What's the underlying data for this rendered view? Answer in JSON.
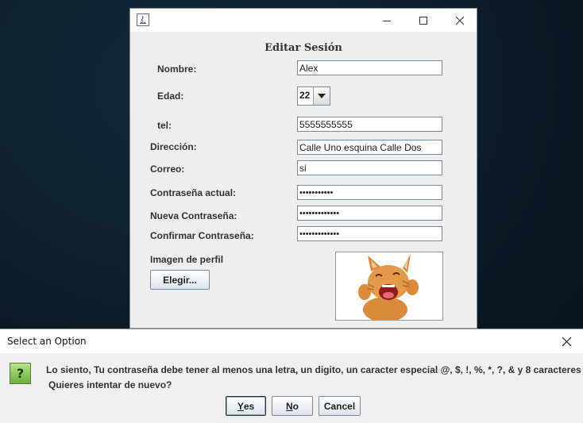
{
  "window": {
    "form_title": "Editar Sesión",
    "labels": {
      "nombre": "Nombre:",
      "edad": "Edad:",
      "tel": "tel:",
      "direccion": "Dirección:",
      "correo": "Correo:",
      "pass_actual": "Contraseña actual:",
      "pass_nueva": "Nueva Contraseña:",
      "pass_confirm": "Confirmar Contraseña:",
      "imagen": "Imagen de perfil"
    },
    "values": {
      "nombre": "Alex",
      "edad": "22",
      "tel": "5555555555",
      "direccion": "Calle Uno esquina Calle Dos",
      "correo": "si",
      "pass_actual": "•••••••••••",
      "pass_nueva": "•••••••••••••",
      "pass_confirm": "•••••••••••••"
    },
    "buttons": {
      "elegir": "Elegir..."
    },
    "profile_image": "cat-photo"
  },
  "dialog": {
    "title": "Select an Option",
    "message_line1": "Lo siento, Tu contraseña debe tener al menos una letra, un digito, un caracter especial @, $, !, %, *, ?, & y 8 caracteres",
    "message_line2": "Quieres intentar de nuevo?",
    "buttons": {
      "yes_first": "Y",
      "yes_rest": "es",
      "no_first": "N",
      "no_rest": "o",
      "cancel": "Cancel"
    },
    "icon": "question-icon"
  },
  "colors": {
    "desktop": "#0d1f2d",
    "icon_green": "#6bb03a"
  }
}
